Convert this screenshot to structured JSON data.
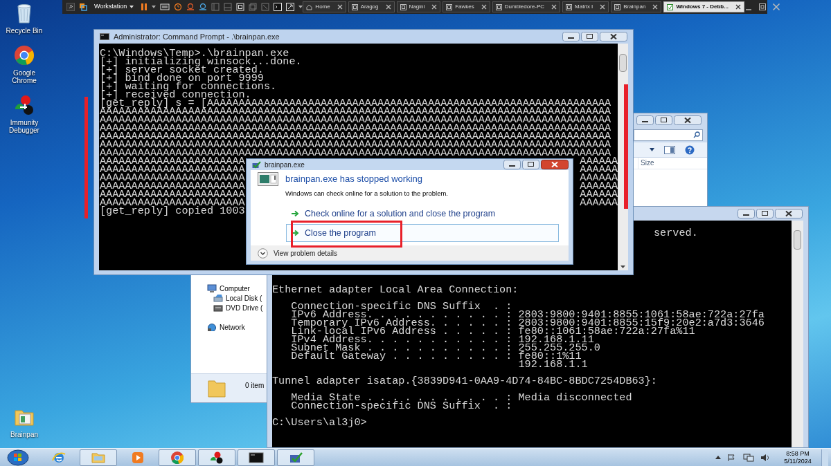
{
  "vm_toolbar": {
    "menu": "Workstation",
    "tabs": [
      {
        "label": "Home",
        "kind": "home",
        "selected": false
      },
      {
        "label": "Aragog",
        "kind": "vm",
        "selected": false
      },
      {
        "label": "Nagini",
        "kind": "vm",
        "selected": false
      },
      {
        "label": "Fawkes",
        "kind": "vm",
        "selected": false
      },
      {
        "label": "Dumbledore-PC",
        "kind": "vm",
        "selected": false
      },
      {
        "label": "Matrix I",
        "kind": "vm",
        "selected": false
      },
      {
        "label": "Brainpan",
        "kind": "vm",
        "selected": false
      },
      {
        "label": "Windows 7 - Debb...",
        "kind": "vm",
        "selected": true
      }
    ]
  },
  "desktop_icons": [
    {
      "label": "Recycle Bin",
      "kind": "recycle"
    },
    {
      "label": "Google Chrome",
      "kind": "chrome"
    },
    {
      "label": "Immunity Debugger",
      "kind": "immunity"
    },
    {
      "label": "Brainpan",
      "kind": "folder"
    }
  ],
  "explorer": {
    "column": "Size",
    "nav": [
      {
        "label": "Computer",
        "kind": "computer",
        "children": [
          {
            "label": "Local Disk (",
            "kind": "disk"
          },
          {
            "label": "DVD Drive (",
            "kind": "dvd"
          }
        ]
      },
      {
        "label": "Network",
        "kind": "network"
      }
    ],
    "status": "0 item"
  },
  "console2": {
    "top_line": "served.",
    "blocks": [
      [
        "Ethernet adapter Local Area Connection:"
      ],
      [
        "   Connection-specific DNS Suffix  . :",
        "   IPv6 Address. . . . . . . . . . . : 2803:9800:9401:8855:1061:58ae:722a:27fa",
        "   Temporary IPv6 Address. . . . . . : 2803:9800:9401:8855:15f9:20e2:a7d3:3646",
        "   Link-local IPv6 Address . . . . . : fe80::1061:58ae:722a:27fa%11",
        "   IPv4 Address. . . . . . . . . . . : 192.168.1.11",
        "   Subnet Mask . . . . . . . . . . . : 255.255.255.0",
        "   Default Gateway . . . . . . . . . : fe80::1%11",
        "                                       192.168.1.1"
      ],
      [
        "Tunnel adapter isatap.{3839D941-0AA9-4D74-84BC-8BDC7254DB63}:"
      ],
      [
        "   Media State . . . . . . . . . . . : Media disconnected",
        "   Connection-specific DNS Suffix  . :"
      ],
      [
        "C:\\Users\\al3j0>"
      ]
    ]
  },
  "console": {
    "title": "Administrator: Command Prompt - .\\brainpan.exe",
    "lines": [
      {
        "text": "C:\\Windows\\Temp>.\\brainpan.exe"
      },
      {
        "text": "[+] initializing winsock...done."
      },
      {
        "text": "[+] server socket created."
      },
      {
        "text": "[+] bind done on port 9999"
      },
      {
        "text": "[+] waiting for connections."
      },
      {
        "text": "[+] received connection."
      },
      {
        "text": "[get_reply] s = [AAAAAAAAAAAAAAAAAAAAAAAAAAAAAAAAAAAAAAAAAAAAAAAAAAAAAAAAAAAAAAAA"
      },
      {
        "text": "AAAAAAAAAAAAAAAAAAAAAAAAAAAAAAAAAAAAAAAAAAAAAAAAAAAAAAAAAAAAAAAAAAAAAAAAAAAAAAAAA"
      },
      {
        "text": "AAAAAAAAAAAAAAAAAAAAAAAAAAAAAAAAAAAAAAAAAAAAAAAAAAAAAAAAAAAAAAAAAAAAAAAAAAAAAAAAA"
      },
      {
        "text": "AAAAAAAAAAAAAAAAAAAAAAAAAAAAAAAAAAAAAAAAAAAAAAAAAAAAAAAAAAAAAAAAAAAAAAAAAAAAAAAAA"
      },
      {
        "text": "AAAAAAAAAAAAAAAAAAAAAAAAAAAAAAAAAAAAAAAAAAAAAAAAAAAAAAAAAAAAAAAAAAAAAAAAAAAAAAAAA"
      },
      {
        "text": "AAAAAAAAAAAAAAAAAAAAAAAAAAAAAAAAAAAAAAAAAAAAAAAAAAAAAAAAAAAAAAAAAAAAAAAAAAAAAAAAA"
      },
      {
        "text": "AAAAAAAAAAAAAAAAAAAAAAAAAAAAAAAAAAAAAAAAAAAAAAAAAAAAAAAAAAAAAAAAAAAAAAAAAAAAAAAAA"
      },
      {
        "left": "AAAAAAAAAAAAAAAAAAAAAAA",
        "right": "AAAAAA"
      },
      {
        "left": "AAAAAAAAAAAAAAAAAAAAAAA",
        "right": "AAAAAA"
      },
      {
        "left": "AAAAAAAAAAAAAAAAAAAAAAA",
        "right": "AAAAAA"
      },
      {
        "left": "AAAAAAAAAAAAAAAAAAAAAAA",
        "right": "AAAAAA"
      },
      {
        "left": "AAAAAAAAAAAAAAAAAAAAAAA",
        "right": "AAAAAA"
      },
      {
        "left": "AAAAAAAAAAAAAAAAAAAAAAA",
        "right": "AAAAAA"
      },
      {
        "text": "[get_reply] copied 1003"
      }
    ]
  },
  "dialog": {
    "title": "brainpan.exe",
    "heading": "brainpan.exe has stopped working",
    "message": "Windows can check online for a solution to the problem.",
    "options": [
      {
        "label": "Check online for a solution and close the program",
        "selected": false
      },
      {
        "label": "Close the program",
        "selected": true
      }
    ],
    "details": "View problem details"
  },
  "taskbar": {
    "apps": [
      {
        "kind": "ie",
        "running": false
      },
      {
        "kind": "explorer",
        "running": true
      },
      {
        "kind": "media",
        "running": false
      },
      {
        "kind": "chrome",
        "running": true
      },
      {
        "kind": "immunity",
        "running": true
      },
      {
        "kind": "cmd",
        "running": true
      },
      {
        "kind": "vm",
        "running": true
      }
    ],
    "time": "8:58 PM",
    "date": "5/11/2024"
  }
}
